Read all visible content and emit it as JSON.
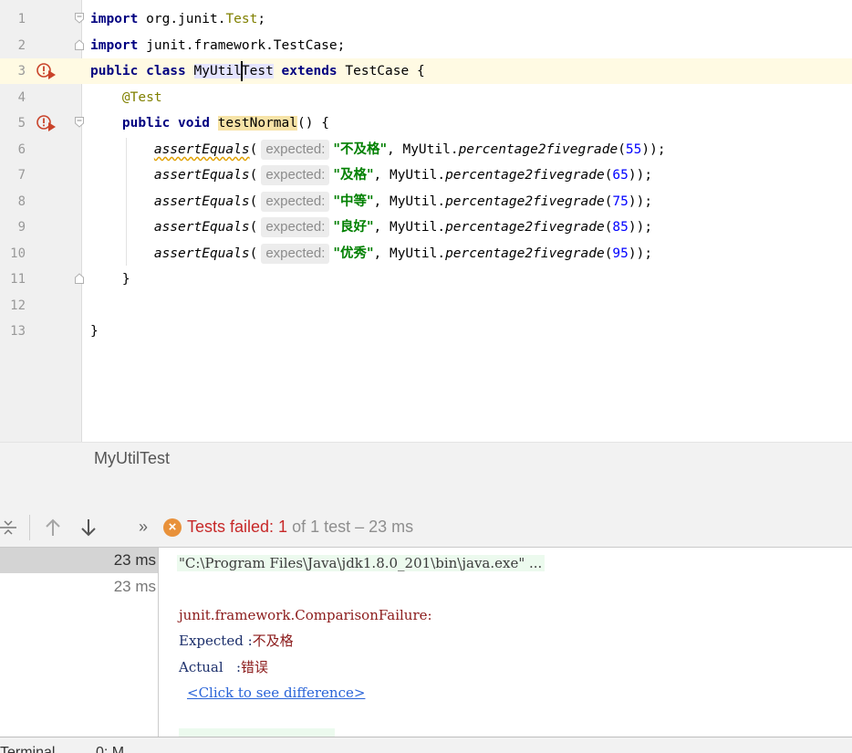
{
  "editor": {
    "line_numbers": [
      "1",
      "2",
      "3",
      "4",
      "5",
      "6",
      "7",
      "8",
      "9",
      "10",
      "11",
      "12",
      "13"
    ],
    "line1": {
      "kw": "import",
      "pkg": "org.junit.",
      "cls": "Test",
      "end": ";"
    },
    "line2": {
      "kw": "import",
      "rest": "junit.framework.TestCase;"
    },
    "line3": {
      "kw1": "public class",
      "name_a": "MyUtil",
      "name_b": "Test",
      "kw2": "extends",
      "parent": "TestCase",
      "brace": "{"
    },
    "line4": {
      "annotation": "@Test"
    },
    "line5": {
      "kw": "public void",
      "method": "testNormal",
      "rest": "() {"
    },
    "asserts": [
      {
        "call": "assertEquals",
        "open": "(",
        "hint": "expected:",
        "str": "\"不及格\"",
        "mid": ", MyUtil.",
        "fn": "percentage2fivegrade",
        "p1": "(",
        "num": "55",
        "end": "));"
      },
      {
        "call": "assertEquals",
        "open": "(",
        "hint": "expected:",
        "str": "\"及格\"",
        "mid": ", MyUtil.",
        "fn": "percentage2fivegrade",
        "p1": "(",
        "num": "65",
        "end": "));"
      },
      {
        "call": "assertEquals",
        "open": "(",
        "hint": "expected:",
        "str": "\"中等\"",
        "mid": ", MyUtil.",
        "fn": "percentage2fivegrade",
        "p1": "(",
        "num": "75",
        "end": "));"
      },
      {
        "call": "assertEquals",
        "open": "(",
        "hint": "expected:",
        "str": "\"良好\"",
        "mid": ", MyUtil.",
        "fn": "percentage2fivegrade",
        "p1": "(",
        "num": "85",
        "end": "));"
      },
      {
        "call": "assertEquals",
        "open": "(",
        "hint": "expected:",
        "str": "\"优秀\"",
        "mid": ", MyUtil.",
        "fn": "percentage2fivegrade",
        "p1": "(",
        "num": "95",
        "end": "));"
      }
    ],
    "line11": "}",
    "line13": "}"
  },
  "breadcrumb": {
    "label": "MyUtilTest"
  },
  "toolbar": {
    "collapse_icon": "collapse-all-icon",
    "prev_icon": "arrow-up-icon",
    "next_icon": "arrow-down-icon",
    "more_icon": "more-icon",
    "more_glyph": "»",
    "fail_glyph": "×",
    "status_failed": "Tests failed: 1",
    "status_rest": "of 1 test – 23 ms"
  },
  "tree": {
    "rows": [
      {
        "time": "23 ms"
      },
      {
        "time": "23 ms"
      }
    ]
  },
  "console": {
    "command": "\"C:\\Program Files\\Java\\jdk1.8.0_201\\bin\\java.exe\" ...",
    "exception": "junit.framework.ComparisonFailure:",
    "expected_label": "Expected :",
    "expected_value": "不及格",
    "actual_label": "Actual   :",
    "actual_value": "错误",
    "diff_link": "<Click to see difference>"
  },
  "bottom": {
    "tab1": "Terminal",
    "tab2": "0: M"
  },
  "colors": {
    "keyword": "#000080",
    "string": "#008000",
    "number": "#0000ff",
    "annotation": "#808000",
    "fail": "#c72828",
    "fail_icon": "#e8913a"
  }
}
